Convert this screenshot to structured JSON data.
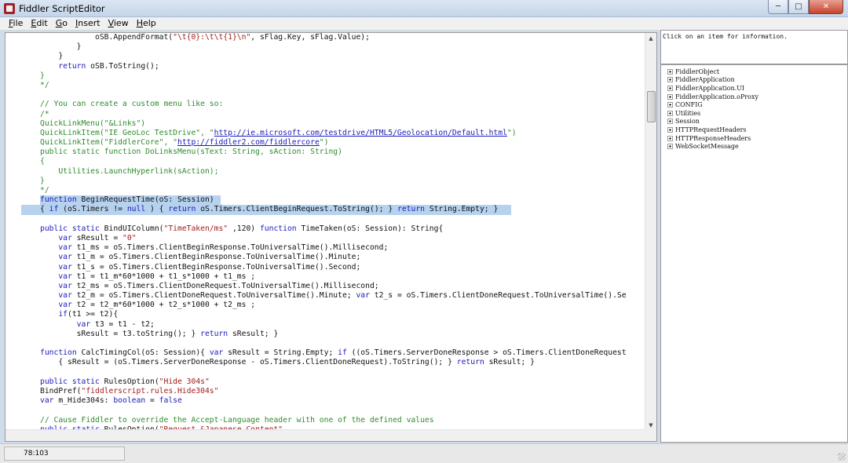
{
  "window": {
    "title": "Fiddler ScriptEditor"
  },
  "menu": [
    {
      "u": "F",
      "rest": "ile"
    },
    {
      "u": "E",
      "rest": "dit"
    },
    {
      "u": "G",
      "rest": "o"
    },
    {
      "u": "I",
      "rest": "nsert"
    },
    {
      "u": "V",
      "rest": "iew"
    },
    {
      "u": "H",
      "rest": "elp"
    }
  ],
  "code_lines": [
    {
      "hl": false,
      "segs": [
        [
          "",
          "            oSB.AppendFormat("
        ],
        [
          "st",
          "\"\\t{0}:\\t\\t{1}\\n\""
        ],
        [
          "",
          ", sFlag.Key, sFlag.Value);"
        ]
      ]
    },
    {
      "hl": false,
      "segs": [
        [
          "",
          "        }"
        ]
      ]
    },
    {
      "hl": false,
      "segs": [
        [
          "",
          "    }"
        ]
      ]
    },
    {
      "hl": false,
      "segs": [
        [
          "",
          "    "
        ],
        [
          "kw",
          "return"
        ],
        [
          "",
          " oSB.ToString();"
        ]
      ]
    },
    {
      "hl": false,
      "segs": [
        [
          "cm",
          "}"
        ]
      ]
    },
    {
      "hl": false,
      "segs": [
        [
          "cm",
          "*/"
        ]
      ]
    },
    {
      "hl": false,
      "segs": [
        [
          "",
          ""
        ]
      ]
    },
    {
      "hl": false,
      "segs": [
        [
          "cm",
          "// You can create a custom menu like so:"
        ]
      ]
    },
    {
      "hl": false,
      "segs": [
        [
          "cm",
          "/*"
        ]
      ]
    },
    {
      "hl": false,
      "segs": [
        [
          "cm",
          "QuickLinkMenu(\"&Links\")"
        ]
      ]
    },
    {
      "hl": false,
      "segs": [
        [
          "cm",
          "QuickLinkItem(\"IE GeoLoc TestDrive\", \""
        ],
        [
          "lk",
          "http://ie.microsoft.com/testdrive/HTML5/Geolocation/Default.html"
        ],
        [
          "cm",
          "\")"
        ]
      ]
    },
    {
      "hl": false,
      "segs": [
        [
          "cm",
          "QuickLinkItem(\"FiddlerCore\", \""
        ],
        [
          "lk",
          "http://fiddler2.com/fiddlercore"
        ],
        [
          "cm",
          "\")"
        ]
      ]
    },
    {
      "hl": false,
      "segs": [
        [
          "cm",
          "public static function DoLinksMenu(sText: String, sAction: String)"
        ]
      ]
    },
    {
      "hl": false,
      "segs": [
        [
          "cm",
          "{"
        ]
      ]
    },
    {
      "hl": false,
      "segs": [
        [
          "cm",
          "    Utilities.LaunchHyperlink(sAction);"
        ]
      ]
    },
    {
      "hl": false,
      "segs": [
        [
          "cm",
          "}"
        ]
      ]
    },
    {
      "hl": false,
      "segs": [
        [
          "cm",
          "*/"
        ]
      ]
    },
    {
      "hl": true,
      "hlw": 230,
      "segs": [
        [
          "kw",
          "function"
        ],
        [
          "",
          " BeginRequestTime(oS: Session)"
        ]
      ]
    },
    {
      "hl": true,
      "hlw": 624,
      "lead": true,
      "segs": [
        [
          "",
          "{ "
        ],
        [
          "kw",
          "if"
        ],
        [
          "",
          " (oS.Timers != "
        ],
        [
          "kw",
          "null"
        ],
        [
          "",
          " ) { "
        ],
        [
          "kw",
          "return"
        ],
        [
          "",
          " oS.Timers.ClientBeginRequest.ToString(); } "
        ],
        [
          "kw",
          "return"
        ],
        [
          "",
          " String.Empty; }"
        ]
      ]
    },
    {
      "hl": false,
      "segs": [
        [
          "",
          ""
        ]
      ]
    },
    {
      "hl": false,
      "segs": [
        [
          "kw",
          "public static"
        ],
        [
          "",
          " BindUIColumn("
        ],
        [
          "st",
          "\"TimeTaken/ms\""
        ],
        [
          "",
          " ,120) "
        ],
        [
          "kw",
          "function"
        ],
        [
          "",
          " TimeTaken(oS: Session): String{"
        ]
      ]
    },
    {
      "hl": false,
      "segs": [
        [
          "",
          "    "
        ],
        [
          "kw",
          "var"
        ],
        [
          "",
          " sResult = "
        ],
        [
          "st",
          "\"0\""
        ],
        [
          ";"
        ]
      ]
    },
    {
      "hl": false,
      "segs": [
        [
          "",
          "    "
        ],
        [
          "kw",
          "var"
        ],
        [
          "",
          " t1_ms = oS.Timers.ClientBeginResponse.ToUniversalTime().Millisecond;"
        ]
      ]
    },
    {
      "hl": false,
      "segs": [
        [
          "",
          "    "
        ],
        [
          "kw",
          "var"
        ],
        [
          "",
          " t1_m = oS.Timers.ClientBeginResponse.ToUniversalTime().Minute;"
        ]
      ]
    },
    {
      "hl": false,
      "segs": [
        [
          "",
          "    "
        ],
        [
          "kw",
          "var"
        ],
        [
          "",
          " t1_s = oS.Timers.ClientBeginResponse.ToUniversalTime().Second;"
        ]
      ]
    },
    {
      "hl": false,
      "segs": [
        [
          "",
          "    "
        ],
        [
          "kw",
          "var"
        ],
        [
          "",
          " t1 = t1_m*60*1000 + t1_s*1000 + t1_ms ;"
        ]
      ]
    },
    {
      "hl": false,
      "segs": [
        [
          "",
          "    "
        ],
        [
          "kw",
          "var"
        ],
        [
          "",
          " t2_ms = oS.Timers.ClientDoneRequest.ToUniversalTime().Millisecond;"
        ]
      ]
    },
    {
      "hl": false,
      "segs": [
        [
          "",
          "    "
        ],
        [
          "kw",
          "var"
        ],
        [
          "",
          " t2_m = oS.Timers.ClientDoneRequest.ToUniversalTime().Minute; "
        ],
        [
          "kw",
          "var"
        ],
        [
          "",
          " t2_s = oS.Timers.ClientDoneRequest.ToUniversalTime().Se"
        ]
      ]
    },
    {
      "hl": false,
      "segs": [
        [
          "",
          "    "
        ],
        [
          "kw",
          "var"
        ],
        [
          "",
          " t2 = t2_m*60*1000 + t2_s*1000 + t2_ms ;"
        ]
      ]
    },
    {
      "hl": false,
      "segs": [
        [
          "",
          "    "
        ],
        [
          "kw",
          "if"
        ],
        [
          "",
          "(t1 >= t2){"
        ]
      ]
    },
    {
      "hl": false,
      "segs": [
        [
          "",
          "        "
        ],
        [
          "kw",
          "var"
        ],
        [
          "",
          " t3 = t1 - t2;"
        ]
      ]
    },
    {
      "hl": false,
      "segs": [
        [
          "",
          "        sResult = t3.toString(); } "
        ],
        [
          "kw",
          "return"
        ],
        [
          "",
          " sResult; }"
        ]
      ]
    },
    {
      "hl": false,
      "segs": [
        [
          "",
          ""
        ]
      ]
    },
    {
      "hl": false,
      "segs": [
        [
          "kw",
          "function"
        ],
        [
          "",
          " CalcTimingCol(oS: Session){ "
        ],
        [
          "kw",
          "var"
        ],
        [
          "",
          " sResult = String.Empty; "
        ],
        [
          "kw",
          "if"
        ],
        [
          "",
          " ((oS.Timers.ServerDoneResponse > oS.Timers.ClientDoneRequest"
        ]
      ]
    },
    {
      "hl": false,
      "segs": [
        [
          "",
          "    { sResult = (oS.Timers.ServerDoneResponse - oS.Timers.ClientDoneRequest).ToString(); } "
        ],
        [
          "kw",
          "return"
        ],
        [
          "",
          " sResult; }"
        ]
      ]
    },
    {
      "hl": false,
      "segs": [
        [
          "",
          ""
        ]
      ]
    },
    {
      "hl": false,
      "segs": [
        [
          "kw",
          "public static"
        ],
        [
          "",
          " RulesOption("
        ],
        [
          "st",
          "\"Hide 304s\""
        ],
        [
          ")"
        ]
      ]
    },
    {
      "hl": false,
      "segs": [
        [
          "",
          "BindPref("
        ],
        [
          "st",
          "\"fiddlerscript.rules.Hide304s\""
        ],
        [
          ")"
        ]
      ]
    },
    {
      "hl": false,
      "segs": [
        [
          "kw",
          "var"
        ],
        [
          "",
          " m_Hide304s: "
        ],
        [
          "kw",
          "boolean"
        ],
        [
          "",
          " = "
        ],
        [
          "kw",
          "false"
        ],
        [
          ";"
        ]
      ]
    },
    {
      "hl": false,
      "segs": [
        [
          "",
          ""
        ]
      ]
    },
    {
      "hl": false,
      "segs": [
        [
          "cm",
          "// Cause Fiddler to override the Accept-Language header with one of the defined values"
        ]
      ]
    },
    {
      "hl": false,
      "segs": [
        [
          "kw",
          "public static"
        ],
        [
          "",
          " RulesOption("
        ],
        [
          "st",
          "\"Request &Japanese Content\""
        ],
        [
          ")"
        ]
      ]
    }
  ],
  "info_text": "Click on an item for information.",
  "tree_items": [
    "FiddlerObject",
    "FiddlerApplication",
    "FiddlerApplication.UI",
    "FiddlerApplication.oProxy",
    "CONFIG",
    "Utilities",
    "Session",
    "HTTPRequestHeaders",
    "HTTPResponseHeaders",
    "WebSocketMessage"
  ],
  "status": {
    "position": "78:103"
  }
}
